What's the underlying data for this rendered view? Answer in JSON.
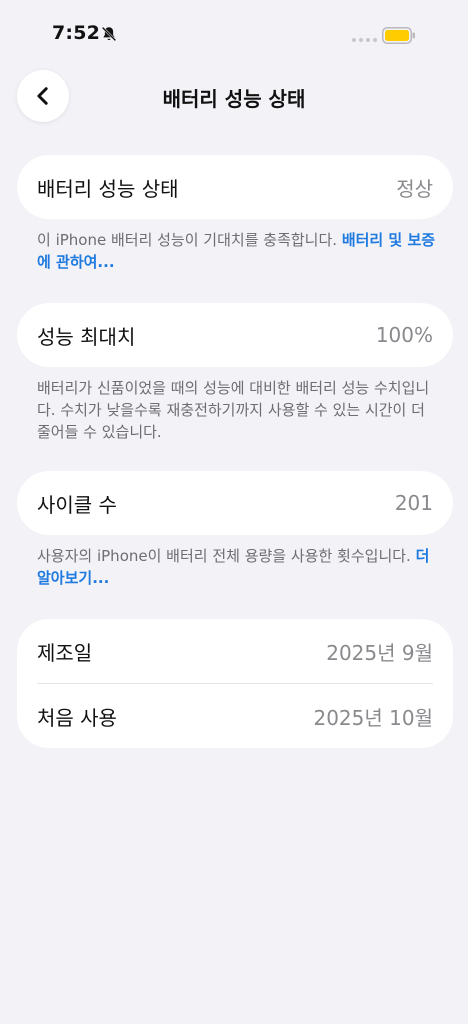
{
  "status_bar": {
    "time": "7:52",
    "icons": [
      "bell-slash-icon",
      "signal-dots-icon",
      "battery-icon"
    ],
    "battery_color": "#ffcc00"
  },
  "nav": {
    "back_icon": "chevron-left-icon",
    "title": "배터리 성능 상태"
  },
  "battery_health": {
    "label": "배터리 성능 상태",
    "value": "정상",
    "footnote_text": "이 iPhone 배터리 성능이 기대치를 충족합니다. ",
    "footnote_link": "배터리 및 보증에 관하여..."
  },
  "max_capacity": {
    "label": "성능 최대치",
    "value": "100%",
    "footnote_text": "배터리가 신품이었을 때의 성능에 대비한 배터리 성능 수치입니다. 수치가 낮을수록 재충전하기까지 사용할 수 있는 시간이 더 줄어들 수 있습니다."
  },
  "cycle_count": {
    "label": "사이클 수",
    "value": "201",
    "footnote_text": "사용자의 iPhone이 배터리 전체 용량을 사용한 횟수입니다. ",
    "footnote_link": "더 알아보기..."
  },
  "dates": {
    "manufacture_label": "제조일",
    "manufacture_value": "2025년 9월",
    "first_use_label": "처음 사용",
    "first_use_value": "2025년 10월"
  },
  "colors": {
    "background": "#f2f2f7",
    "link": "#1f7ae0",
    "secondary_text": "#8a8a8e"
  }
}
